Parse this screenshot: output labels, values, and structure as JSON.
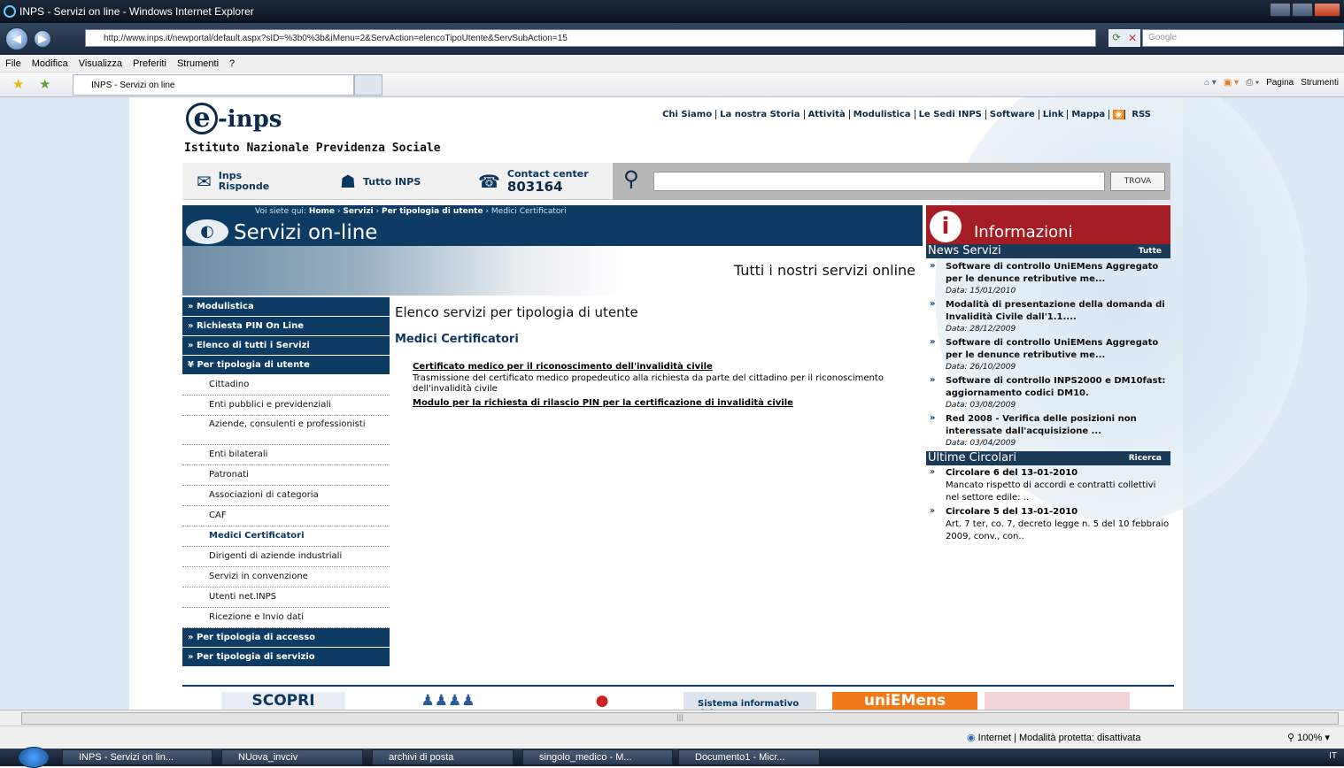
{
  "window": {
    "title": "INPS - Servizi on line - Windows Internet Explorer"
  },
  "address": {
    "url": "http://www.inps.it/newportal/default.aspx?sID=%3b0%3b&iMenu=2&ServAction=elencoTipoUtente&ServSubAction=15",
    "search_placeholder": "Google"
  },
  "menubar": [
    "File",
    "Modifica",
    "Visualizza",
    "Preferiti",
    "Strumenti",
    "?"
  ],
  "tab": {
    "label": "INPS - Servizi on line"
  },
  "toolbar": {
    "page": "Pagina",
    "tools": "Strumenti"
  },
  "site": {
    "logo": "e-inps",
    "org": "Istituto Nazionale Previdenza Sociale",
    "topnav": [
      "Chi Siamo",
      "La nostra Storia",
      "Attività",
      "Modulistica",
      "Le Sedi INPS",
      "Software",
      "Link",
      "Mappa",
      "RSS"
    ],
    "tools": {
      "inps_risponde_1": "Inps",
      "inps_risponde_2": "Risponde",
      "tutto": "Tutto INPS",
      "contact_label": "Contact center",
      "contact_number": "803164",
      "search_button": "TROVA"
    },
    "breadcrumb": {
      "prefix": "Voi siete qui:",
      "home": "Home",
      "servizi": "Servizi",
      "tipologia": "Per tipologia di utente",
      "current": "Medici Certificatori"
    },
    "section_title": "Servizi on-line",
    "banner_text": "Tutti i nostri servizi online",
    "leftnav": {
      "top": [
        "» Modulistica",
        "» Richiesta PIN On Line",
        "» Elenco di tutti i Servizi"
      ],
      "open": "¥ Per tipologia di utente",
      "sub": [
        "Cittadino",
        "Enti pubblici e previdenziali",
        "Aziende, consulenti e professionisti",
        "Enti bilaterali",
        "Patronati",
        "Associazioni di categoria",
        "CAF",
        "Medici Certificatori",
        "Dirigenti di aziende industriali",
        "Servizi in convenzione",
        "Utenti net.INPS",
        "Ricezione e Invio dati"
      ],
      "bottom": [
        "» Per tipologia di accesso",
        "» Per tipologia di servizio"
      ]
    },
    "main": {
      "title": "Elenco servizi per tipologia di utente",
      "subtitle": "Medici Certificatori",
      "link1": "Certificato medico per il riconoscimento dell'invalidità civile",
      "desc1": "Trasmissione del certificato medico propedeutico alla richiesta da parte del cittadino per il riconoscimento dell'invalidità civile",
      "link2": "Modulo per la richiesta di rilascio PIN per la certificazione di invalidità civile"
    },
    "info": {
      "title": "Informazioni",
      "news_head": "News Servizi",
      "news_all": "Tutte",
      "news": [
        {
          "title": "Software di controllo UniEMens Aggregato per le denunce retributive me...",
          "date": "Data: 15/01/2010"
        },
        {
          "title": "Modalità di presentazione della domanda di Invalidità Civile dall'1.1....",
          "date": "Data: 28/12/2009"
        },
        {
          "title": "Software di controllo UniEMens Aggregato per le denunce retributive me...",
          "date": "Data: 26/10/2009"
        },
        {
          "title": "Software di controllo INPS2000 e DM10fast: aggiornamento codici DM10.",
          "date": "Data: 03/08/2009"
        },
        {
          "title": "Red 2008 - Verifica delle posizioni non interessate dall'acquisizione ...",
          "date": "Data: 03/04/2009"
        }
      ],
      "circ_head": "Ultime Circolari",
      "circ_search": "Ricerca",
      "circolari": [
        {
          "title": "Circolare 6 del 13-01-2010",
          "text": "Mancato rispetto di accordi e contratti collettivi nel settore edile: .."
        },
        {
          "title": "Circolare 5 del 13-01-2010",
          "text": "Art. 7 ter, co. 7, decreto legge n. 5 del 10 febbraio 2009, conv., con.."
        }
      ]
    },
    "bottom": {
      "scopri": "SCOPRI",
      "sistema": "Sistema informativo dei",
      "uniemens": "uniEMens"
    }
  },
  "status": {
    "zone": "Internet | Modalità protetta: disattivata",
    "zoom": "100%"
  },
  "taskbar": {
    "items": [
      "INPS - Servizi on lin...",
      "NUova_invciv",
      "archivi di posta",
      "singolo_medico - M...",
      "Documento1 - Micr..."
    ],
    "tray": "IT"
  }
}
